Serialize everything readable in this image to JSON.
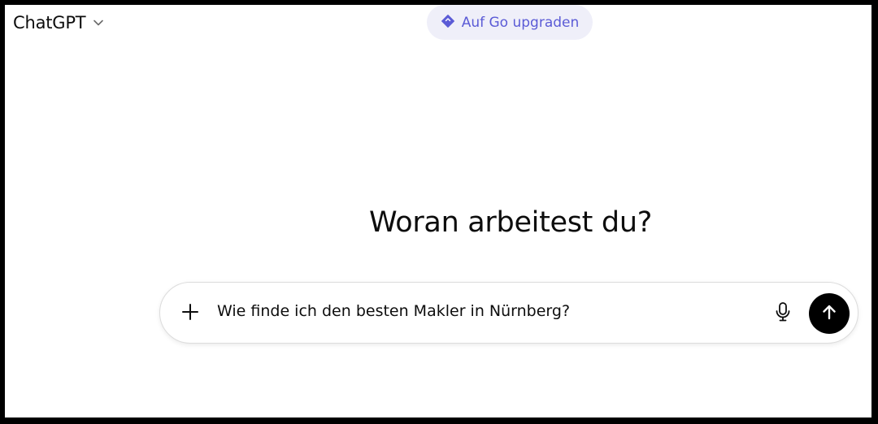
{
  "header": {
    "model_name": "ChatGPT",
    "model_dropdown_icon": "chevron-down-icon",
    "upgrade_label": "Auf Go upgraden",
    "upgrade_icon": "diamond-icon"
  },
  "main": {
    "headline": "Woran arbeitest du?"
  },
  "composer": {
    "add_icon": "plus-icon",
    "prompt_value": "Wie finde ich den besten Makler in Nürnberg?",
    "mic_icon": "microphone-icon",
    "send_icon": "arrow-up-icon"
  },
  "colors": {
    "accent": "#5b5bd6",
    "pill_background": "#efeff9",
    "send_button": "#000000",
    "text": "#0d0d0d"
  }
}
